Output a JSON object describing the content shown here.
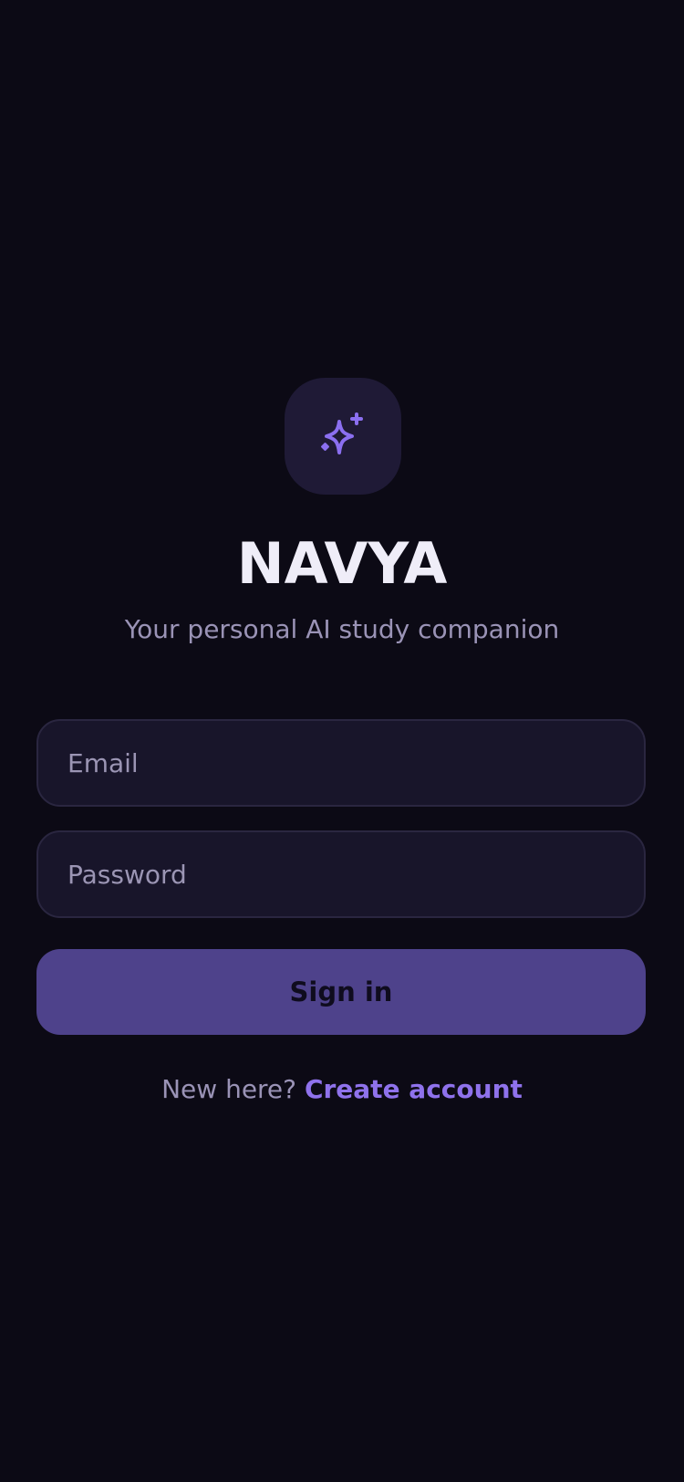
{
  "brand": {
    "title": "NAVYA",
    "subtitle": "Your personal AI study companion",
    "logo_icon": "sparkles-icon"
  },
  "form": {
    "email": {
      "placeholder": "Email",
      "value": ""
    },
    "password": {
      "placeholder": "Password",
      "value": ""
    },
    "submit_label": "Sign in"
  },
  "footer": {
    "prompt": "New here?",
    "link_label": "Create account"
  },
  "colors": {
    "background": "#0c0a15",
    "accent": "#8f72ec",
    "button": "#4e428b",
    "field": "#18152a"
  }
}
